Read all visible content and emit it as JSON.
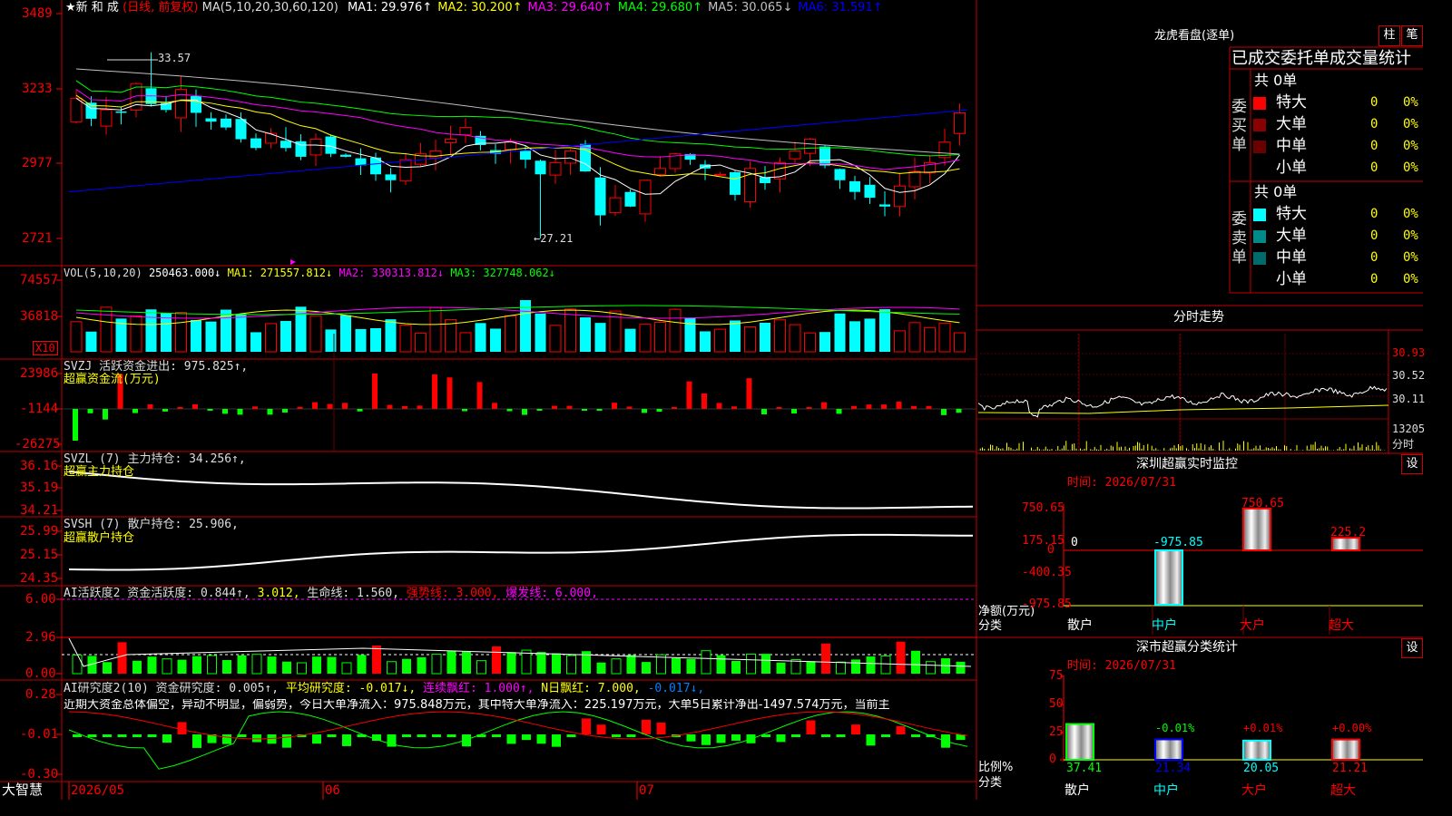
{
  "colors": {
    "up": "#ff0000",
    "down": "#00ffff",
    "frame": "#c00000",
    "ma1": "#ffffff",
    "ma2": "#ffff00",
    "ma3": "#ff00ff",
    "ma4": "#00ff00",
    "ma5": "#c0c0c0",
    "ma6": "#0000ff",
    "green": "#00ff00",
    "yellow": "#ffff00",
    "magenta": "#ff00ff"
  },
  "main": {
    "stock_name": "★新 和 成",
    "mode": "(日线, 前复权)",
    "ma_params": "MA(5,10,20,30,60,120)",
    "ma": [
      {
        "label": "MA1: 29.976↑",
        "color": "ma1"
      },
      {
        "label": "MA2: 30.200↑",
        "color": "ma2"
      },
      {
        "label": "MA3: 29.640↑",
        "color": "ma3"
      },
      {
        "label": "MA4: 29.680↑",
        "color": "ma4"
      },
      {
        "label": "MA5: 30.065↓",
        "color": "ma5"
      },
      {
        "label": "MA6: 31.591↑",
        "color": "ma6"
      }
    ],
    "y_ticks": [
      "3489",
      "3233",
      "2977",
      "2721"
    ],
    "high_label": "33.57",
    "low_label": "←27.21"
  },
  "vol": {
    "title": "VOL(5,10,20)",
    "value": "250463.000↓",
    "ma1": "MA1: 271557.812↓",
    "ma2": "MA2: 330313.812↓",
    "ma3": "MA3: 327748.062↓",
    "y_ticks": [
      "74557",
      "36818"
    ],
    "unit": "X10"
  },
  "svzj": {
    "title": "SVZJ  活跃资金进出: 975.825↑,",
    "sub": "超赢资金流(万元)",
    "y_ticks": [
      "23986",
      "-1144",
      "-26275"
    ]
  },
  "svzl": {
    "title": "SVZL (7) 主力持仓: 34.256↑,",
    "sub": "超赢主力持仓",
    "y_ticks": [
      "36.16",
      "35.19",
      "34.21"
    ]
  },
  "svsh": {
    "title": "SVSH (7) 散户持仓: 25.906,",
    "sub": "超赢散户持仓",
    "y_ticks": [
      "25.99",
      "25.15",
      "24.35"
    ]
  },
  "ai1": {
    "title": "AI活跃度2 资金活跃度: 0.844↑,",
    "v2": "3.012,",
    "v3": "生命线: 1.560,",
    "v4": "强势线: 3.000,",
    "v5": "爆发线: 6.000,",
    "y_ticks": [
      "6.00",
      "2.96",
      "0.00"
    ]
  },
  "ai2": {
    "title": "AI研究度2(10) 资金研究度: 0.005↑,",
    "v2": "平均研究度: -0.017↓,",
    "v3": "连续飘红: 1.000↑,",
    "v4": "N日飘红: 7.000,",
    "v5": "-0.017↓,",
    "summary": "近期大资金总体偏空，异动不明显，偏弱势，今日大单净流入：975.848万元，其中特大单净流入：225.197万元，大单5日累计净出-1497.574万元，当前主",
    "y_ticks": [
      "0.28",
      "-0.01",
      "-0.30"
    ]
  },
  "xaxis": {
    "brand": "大智慧",
    "labels": [
      "2026/05",
      "06",
      "07"
    ]
  },
  "lhb": {
    "title": "龙虎看盘(逐单)",
    "btn1": "柱",
    "btn2": "笔",
    "header": "已成交委托单成交量统计",
    "buy": {
      "label": "委买单",
      "total": "共 0单",
      "rows": [
        {
          "name": "特大",
          "count": "0",
          "pct": "0%",
          "color": "#ff0000"
        },
        {
          "name": "大单",
          "count": "0",
          "pct": "0%",
          "color": "#8b0000"
        },
        {
          "name": "中单",
          "count": "0",
          "pct": "0%",
          "color": "#6b0000"
        },
        {
          "name": "小单",
          "count": "0",
          "pct": "0%",
          "color": ""
        }
      ]
    },
    "sell": {
      "label": "委卖单",
      "total": "共 0单",
      "rows": [
        {
          "name": "特大",
          "count": "0",
          "pct": "0%",
          "color": "#00ffff"
        },
        {
          "name": "大单",
          "count": "0",
          "pct": "0%",
          "color": "#008b8b"
        },
        {
          "name": "中单",
          "count": "0",
          "pct": "0%",
          "color": "#006b6b"
        },
        {
          "name": "小单",
          "count": "0",
          "pct": "0%",
          "color": ""
        }
      ]
    }
  },
  "fenshi": {
    "title": "分时走势",
    "y_ticks": [
      "30.93",
      "30.52",
      "30.11"
    ],
    "vol_tick": "13205",
    "vol_label": "分时"
  },
  "monitor": {
    "title": "深圳超赢实时监控",
    "btn": "设",
    "time": "时间: 2026/07/31",
    "y_ticks": [
      "750.65",
      "175.15",
      "0",
      "-400.35",
      "-975.85"
    ],
    "y_label": "净额(万元)",
    "x_label": "分类",
    "cats": [
      "散户",
      "中户",
      "大户",
      "超大"
    ],
    "values": [
      0,
      -975.85,
      750.65,
      225.2
    ],
    "value_labels": [
      "0",
      "-975.85",
      "750.65",
      "225.2"
    ]
  },
  "stats": {
    "title": "深市超赢分类统计",
    "btn": "设",
    "time": "时间: 2026/07/31",
    "y_ticks": [
      "75",
      "50",
      "25",
      "0"
    ],
    "y_label": "比例%",
    "x_label": "分类",
    "cats": [
      "散户",
      "中户",
      "大户",
      "超大"
    ],
    "values": [
      37.41,
      21.34,
      20.05,
      21.21
    ],
    "value_labels": [
      "37.41",
      "21.34",
      "20.05",
      "21.21"
    ],
    "change_labels": [
      "",
      "-0.01%",
      "+0.01%",
      "+0.00%"
    ]
  },
  "chart_data": [
    {
      "type": "candlestick",
      "title": "新和成 日线 前复权",
      "x_labels": [
        "2026/05",
        "06",
        "07"
      ],
      "y_ticks": [
        3489,
        3233,
        2977,
        2721
      ],
      "high": 33.57,
      "low": 27.21,
      "ma_latest": {
        "MA1": 29.976,
        "MA2": 30.2,
        "MA3": 29.64,
        "MA4": 29.68,
        "MA5": 30.065,
        "MA6": 31.591
      }
    },
    {
      "type": "bar",
      "title": "VOL(5,10,20)",
      "latest": 250463.0,
      "ma": {
        "MA1": 271557.812,
        "MA2": 330313.812,
        "MA3": 327748.062
      }
    },
    {
      "type": "bar",
      "title": "超赢资金流(万元)",
      "latest": 975.825
    },
    {
      "type": "line",
      "title": "超赢主力持仓",
      "latest": 34.256,
      "ylim": [
        34.21,
        36.16
      ]
    },
    {
      "type": "line",
      "title": "超赢散户持仓",
      "latest": 25.906,
      "ylim": [
        24.35,
        25.99
      ]
    },
    {
      "type": "bar",
      "title": "深圳超赢实时监控",
      "categories": [
        "散户",
        "中户",
        "大户",
        "超大"
      ],
      "values": [
        0,
        -975.85,
        750.65,
        225.2
      ]
    },
    {
      "type": "bar",
      "title": "深市超赢分类统计",
      "categories": [
        "散户",
        "中户",
        "大户",
        "超大"
      ],
      "values": [
        37.41,
        21.34,
        20.05,
        21.21
      ]
    }
  ]
}
